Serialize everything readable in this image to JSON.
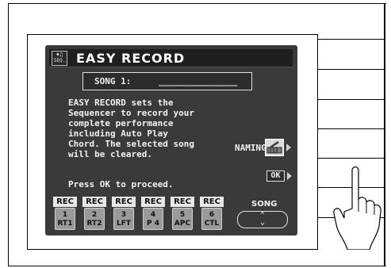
{
  "header": {
    "icon_label": "SEQ.",
    "title": "EASY RECORD"
  },
  "song": {
    "label": "SONG 1:",
    "name": "_______________"
  },
  "description": [
    "EASY RECORD sets the",
    "Sequencer to record your",
    "complete performance",
    "including Auto Play",
    "Chord. The selected song",
    "will be cleared."
  ],
  "prompt": "Press OK to proceed.",
  "naming": {
    "label": "NAMING",
    "icon": "keyboard-icon"
  },
  "ok": {
    "label": "OK"
  },
  "tracks": [
    {
      "status": "REC",
      "number": "1",
      "name": "RT1"
    },
    {
      "status": "REC",
      "number": "2",
      "name": "RT2"
    },
    {
      "status": "REC",
      "number": "3",
      "name": "LFT"
    },
    {
      "status": "REC",
      "number": "4",
      "name": "P 4"
    },
    {
      "status": "REC",
      "number": "5",
      "name": "APC"
    },
    {
      "status": "REC",
      "number": "6",
      "name": "CTL"
    }
  ],
  "song_selector": {
    "label": "SONG",
    "icon": "up-down-icon"
  },
  "colors": {
    "screen": "#3a3a3a",
    "text": "#f2f2f2",
    "track_button": "#9a9a9a"
  }
}
